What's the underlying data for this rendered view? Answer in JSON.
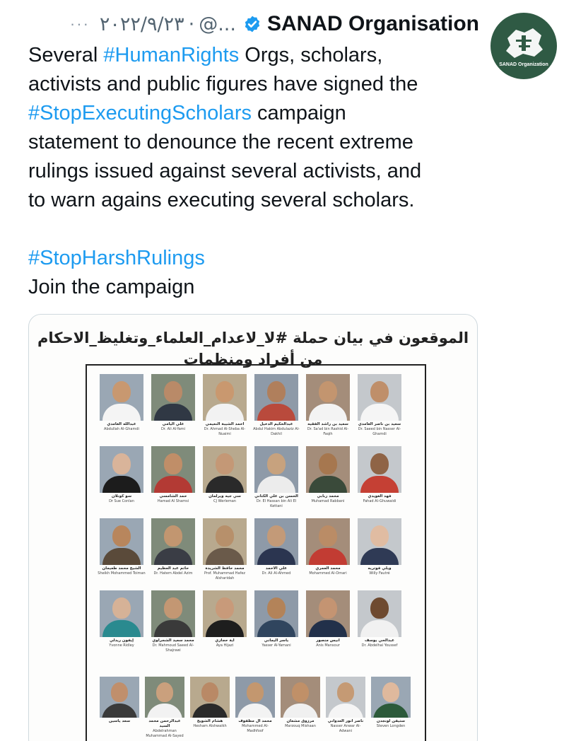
{
  "tweet": {
    "more": "···",
    "date": "٢٠٢٢/٩/٢٣",
    "separator": "·",
    "handle": "@...",
    "author": "SANAD Organisation",
    "avatar_label": "SANAD Organization",
    "lines": [
      [
        {
          "t": "Several "
        },
        {
          "t": "#HumanRights",
          "tag": true
        },
        {
          "t": " Orgs, scholars,"
        }
      ],
      [
        {
          "t": "activists and public figures have signed the"
        }
      ],
      [
        {
          "t": "#StopExecutingScholars",
          "tag": true
        },
        {
          "t": " campaign"
        }
      ],
      [
        {
          "t": "statement to denounce the recent extreme"
        }
      ],
      [
        {
          "t": "rulings issued against several activists, and"
        }
      ],
      [
        {
          "t": "to warn agains executing several scholars."
        }
      ],
      [],
      [
        {
          "t": "#StopHarshRulings",
          "tag": true
        }
      ],
      [
        {
          "t": "Join the campaign"
        }
      ]
    ]
  },
  "poster": {
    "title_line1": "الموقعون في بيان حملة #لا_لاعدام_العلماء_وتغليظ_الاحكام",
    "title_line2": "من أفراد ومنظمات",
    "people": [
      {
        "ar": "عبدالله الغامدي",
        "en": "Abdullah Al-Ghamdi",
        "skin": "#c89870",
        "cloth": "#f4f4f4"
      },
      {
        "ar": "علي اليامي",
        "en": "Dr. Ali Al-Yami",
        "skin": "#b98a68",
        "cloth": "#303844"
      },
      {
        "ar": "أحمد الشيبة النعيمي",
        "en": "Dr. Ahmad Al-Sheba Al-Nuaimi",
        "skin": "#c9986f",
        "cloth": "#f2f2f2"
      },
      {
        "ar": "عبدالحكيم الدخيل",
        "en": "Abdul Hakim Abdulaziz Al-Dakhil",
        "skin": "#b07f5c",
        "cloth": "#b94a3c"
      },
      {
        "ar": "سعيد بن راشد الفقيه",
        "en": "Dr. Sa'ad bin Rashid Al-Faqih",
        "skin": "#c3956f",
        "cloth": "#f3f3f3"
      },
      {
        "ar": "سعيد بن ناصر الغامدي",
        "en": "Dr. Saeed bin Nasser Al-Ghamdi",
        "skin": "#bf8f6a",
        "cloth": "#f5f5f5"
      },
      {
        "ar": "سو كونلان",
        "en": "Dr Sue Conlan",
        "skin": "#d9b49a",
        "cloth": "#1c1c1c"
      },
      {
        "ar": "حمد الشامسي",
        "en": "Hamad Al Shamsi",
        "skin": "#c08e68",
        "cloth": "#b33a34"
      },
      {
        "ar": "سي جيه ويرلمان",
        "en": "CJ Werleman",
        "skin": "#c49876",
        "cloth": "#2a2a2a"
      },
      {
        "ar": "الحسن بن علي الكتاني",
        "en": "Dr. El Hassan bin Ali El Kettani",
        "skin": "#c7a27e",
        "cloth": "#ececec"
      },
      {
        "ar": "محمد ربابي",
        "en": "Muhamad Rabbani",
        "skin": "#a6774f",
        "cloth": "#3a4a3a"
      },
      {
        "ar": "فهد الغويدي",
        "en": "Fahad Al-Ghuwaidi",
        "skin": "#8f6446",
        "cloth": "#c54034"
      },
      {
        "ar": "الشيخ محمد طعيمان",
        "en": "Sheikh Mohammed Toiman",
        "skin": "#b8865d",
        "cloth": "#5a4a3a"
      },
      {
        "ar": "حاتم عبد العظيم",
        "en": "Dr. Hatem Abdel Azim",
        "skin": "#c29670",
        "cloth": "#3a3d45"
      },
      {
        "ar": "محمد حافظ الشريدة",
        "en": "Prof. Muhammad Hafez Alsharidah",
        "skin": "#b7906b",
        "cloth": "#6a5a4a"
      },
      {
        "ar": "علي الأحمد",
        "en": "Dr. Ali Al-Ahmed",
        "skin": "#c39a78",
        "cloth": "#2b3550"
      },
      {
        "ar": "محمد العمري",
        "en": "Mohammed Al-Omari",
        "skin": "#ba8c66",
        "cloth": "#c23c33"
      },
      {
        "ar": "ويلي فوتريه",
        "en": "Willy Fautré",
        "skin": "#e0bca2",
        "cloth": "#2f3a55"
      },
      {
        "ar": "إيفون ريدلي",
        "en": "Yvonne Ridley",
        "skin": "#d6b297",
        "cloth": "#2a8a8f"
      },
      {
        "ar": "محمد سعيد الشجراوي",
        "en": "Dr. Mahmoud Saeed Al-Shajrawi",
        "skin": "#c39773",
        "cloth": "#3a3a3a"
      },
      {
        "ar": "أية حجازي",
        "en": "Aya Hijazi",
        "skin": "#c89a7a",
        "cloth": "#1e1e1e"
      },
      {
        "ar": "ياسر اليماني",
        "en": "Yasser Al-Yamani",
        "skin": "#b38359",
        "cloth": "#30455e"
      },
      {
        "ar": "أنيس منصور",
        "en": "Anis Mansour",
        "skin": "#c49472",
        "cloth": "#22304a"
      },
      {
        "ar": "عبدالحي يوسف",
        "en": "Dr. Abdelhai Youssef",
        "skin": "#6e4a30",
        "cloth": "#f1f1f1"
      }
    ],
    "row5": [
      {
        "ar": "سعد ياسين",
        "en": "",
        "skin": "#c08f6c",
        "cloth": "#3a3a3a"
      },
      {
        "ar": "عبدالرحمن محمد السيد",
        "en": "Abdelrahman Muhammad Al-Sayed",
        "skin": "#caa07d",
        "cloth": "#f2f2f2"
      },
      {
        "ar": "هشام الشويخ",
        "en": "Hesham Alshwaikh",
        "skin": "#b98966",
        "cloth": "#2a2a2a"
      },
      {
        "ar": "محمد آل مظفوف",
        "en": "Mohammed Al-Madhfoof",
        "skin": "#c3976f",
        "cloth": "#f3f3f3"
      },
      {
        "ar": "مرزوق مشعان",
        "en": "Marzouq Mishaan",
        "skin": "#c09068",
        "cloth": "#f0f0f0"
      },
      {
        "ar": "ناصر أنور العدواني",
        "en": "Nasser Anwar Al-Adwani",
        "skin": "#c59a74",
        "cloth": "#f5f5f5"
      },
      {
        "ar": "ستيفن لونجدن",
        "en": "Steven Longden",
        "skin": "#dfb99d",
        "cloth": "#2c5a3a"
      }
    ]
  }
}
